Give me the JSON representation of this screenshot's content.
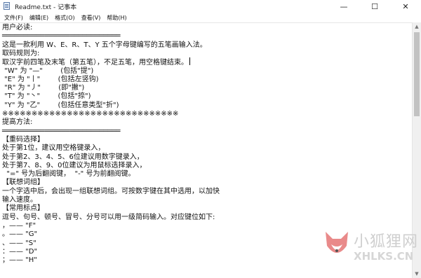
{
  "window": {
    "title": "Readme.txt - 记事本",
    "minimize_glyph": "—",
    "maximize_glyph": "☐",
    "close_glyph": "✕"
  },
  "menu": [
    "文件(F)",
    "编辑(E)",
    "格式(O)",
    "查看(V)",
    "帮助(H)"
  ],
  "document": {
    "lines": [
      "用户必读:",
      "════════════════════════════",
      "这是一款利用 W、E、R、T、Y 五个字母键编写的五笔画输入法。",
      "取码规则为:",
      "取汉字前四笔及末笔（第五笔），不足五笔，用空格键结束。",
      " \"W\" 为 \"—\"        (包括\"提\")",
      " \"E\" 为 \"丨\"        (包括左竖钩)",
      " \"R\" 为 \"丿\"        (即\"撇\")",
      " \"T\" 为 \"丶\"        (包括\"捺\")",
      " \"Y\" 为 \"乙\"        (包括任意类型\"折\")",
      "※※※※※※※※※※※※※※※※※※※※※※※※※※※※※※",
      "提高方法:",
      "════════════════════════════",
      "【重码选择】",
      "处于第1位，建议用空格键录入，",
      "处于第2、3、4、5、6位建议用数字键录入，",
      "处于第7、8、9、0位建议为用鼠标选择录入，",
      "  \"=\" 号为后翻阅键，  \"-\" 号为前翻阅键。",
      "【联想词组】",
      "一个字选中后，会出现一组联想词组。可按数字键在其中选用，以加快",
      "输入速度。",
      "【常用标点】",
      "逗号、句号、顿号、冒号、分号可以用一级简码输入。对应键位如下:",
      "，—— \"F\"",
      "。—— \"G\"",
      "、—— \"S\"",
      "：—— \"D\"",
      "；—— \"H\""
    ]
  },
  "scrollbar": {
    "up_glyph": "▲",
    "down_glyph": "▼"
  },
  "watermark": {
    "cn": "小狐狸网",
    "en": "XHLKS.CN",
    "logo_color": "#e98a8a"
  }
}
